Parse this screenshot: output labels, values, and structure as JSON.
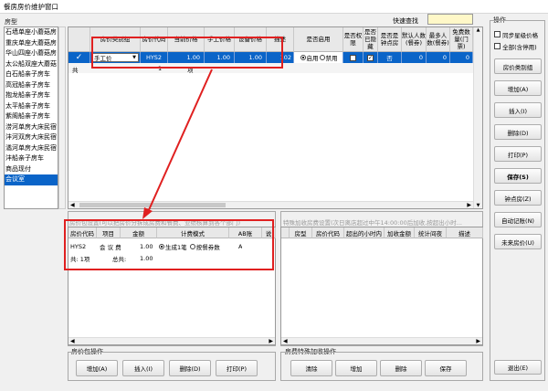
{
  "window": {
    "title": "餐房房价维护窗口"
  },
  "room_type_group": {
    "legend": "房型",
    "items": [
      "石墙单座小蘑菇房",
      "重庆单座大蘑菇房",
      "华山四座小蘑菇房",
      "太公船双座大蘑菇",
      "白石船亲子房车",
      "高冠船亲子房车",
      "抱龙船亲子房车",
      "太平船亲子房车",
      "紫阁船亲子房车",
      "涝河单房大床民宿",
      "沣河双房大床民宿",
      "潏河单房大床民宿",
      "沣船亲子房车",
      "商品现付",
      "会议室"
    ],
    "selected_index": 14
  },
  "quick_search": {
    "label": "快速查找",
    "value": ""
  },
  "price_grid": {
    "headers": [
      "房价类别组",
      "房价代码",
      "当前价格",
      "手工价格",
      "设备价格",
      "描述",
      "是否启用",
      "是否权限",
      "是否已隐藏",
      "是否是钟点房",
      "默认人数(餐券)",
      "最多人数(餐券)",
      "免费数量(门票)"
    ],
    "row": {
      "category": "手工价",
      "code": "HYS2",
      "current": "1.00",
      "manual": "1.00",
      "device": "1.00",
      "desc": "102",
      "enable_on": "启用",
      "enable_off": "禁用",
      "hourly": "否",
      "default_people": "0",
      "max_people": "0",
      "free_qty": "0"
    },
    "total_label": "共",
    "total_count": "1",
    "total_unit": "项"
  },
  "right_group": {
    "legend": "操作",
    "checks": [
      "同步星级价格",
      "全部(含停用)"
    ],
    "buttons": [
      "房价类别组",
      "增加(A)",
      "插入(I)",
      "删除(D)",
      "打印(P)",
      "保存(S)",
      "钟点房(Z)",
      "自动记账(N)",
      "未来房价(U)"
    ],
    "exit": "退出(E)"
  },
  "package_panel": {
    "caption": "房价包设置(可以把房价分拆成房费和餐费、业绩核算到各个部门)",
    "headers": [
      "房价代码",
      "项目",
      "金额",
      "计费模式",
      "AB账",
      "说"
    ],
    "row": {
      "code": "HYS2",
      "item": "会 议 费",
      "amount": "1.00",
      "mode_on": "生成1笔",
      "mode_off": "按餐券数",
      "ab": "A"
    },
    "total_label": "共: 1项",
    "total_sum_label": "总共:",
    "total_sum": "1.00"
  },
  "special_panel": {
    "caption": "特殊加收房费设置(次日离店超过中午14:00:00后加收,按超出小时...",
    "headers": [
      "房型",
      "房价代码",
      "超出的小时内",
      "加收金额",
      "统计间夜",
      "描述"
    ]
  },
  "package_ops": {
    "legend": "房价包操作",
    "buttons": [
      "增加(A)",
      "插入(I)",
      "删除(D)",
      "打印(P)"
    ]
  },
  "special_ops": {
    "legend": "房费特殊加收操作",
    "buttons": [
      "清除",
      "增加",
      "删除",
      "保存"
    ]
  }
}
